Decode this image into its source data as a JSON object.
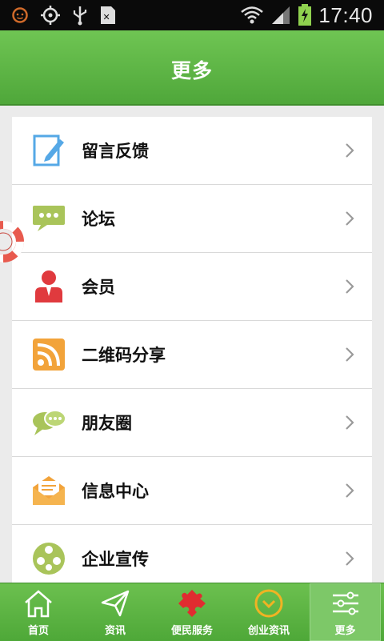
{
  "status_bar": {
    "time": "17:40",
    "icons": [
      "notification-face-icon",
      "gps-icon",
      "usb-icon",
      "sim-card-icon",
      "wifi-icon",
      "signal-icon",
      "battery-charging-icon"
    ]
  },
  "header": {
    "title": "更多"
  },
  "menu": {
    "items": [
      {
        "label": "留言反馈",
        "icon": "edit-note-icon"
      },
      {
        "label": "论坛",
        "icon": "chat-bubble-icon"
      },
      {
        "label": "会员",
        "icon": "member-icon"
      },
      {
        "label": "二维码分享",
        "icon": "rss-icon"
      },
      {
        "label": "朋友圈",
        "icon": "friends-chat-icon"
      },
      {
        "label": "信息中心",
        "icon": "envelope-icon"
      },
      {
        "label": "企业宣传",
        "icon": "film-reel-icon"
      }
    ]
  },
  "tabbar": {
    "items": [
      {
        "label": "首页",
        "icon": "home-icon"
      },
      {
        "label": "资讯",
        "icon": "paper-plane-icon"
      },
      {
        "label": "便民服务",
        "icon": "puzzle-icon"
      },
      {
        "label": "创业资讯",
        "icon": "clock-icon"
      },
      {
        "label": "更多",
        "icon": "sliders-icon"
      }
    ],
    "active_index": 4
  },
  "colors": {
    "header_green": "#5bb544",
    "chevron": "#9a9a9a",
    "icon_blue": "#55a8e6",
    "icon_olive": "#a9c45a",
    "icon_red": "#e03a3e",
    "icon_orange": "#f2a33a"
  }
}
